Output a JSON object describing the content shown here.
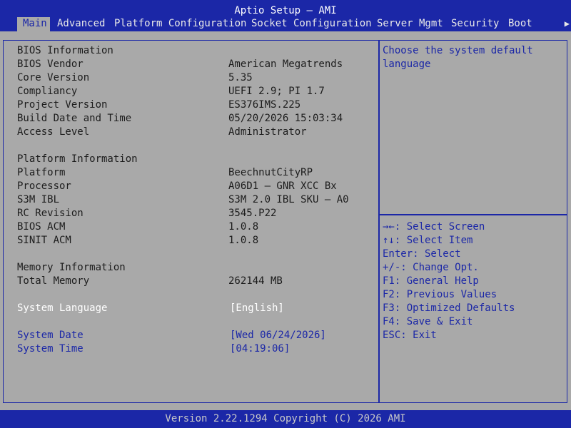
{
  "title": "Aptio Setup – AMI",
  "tabs": [
    "Main",
    "Advanced",
    "Platform Configuration",
    "Socket Configuration",
    "Server Mgmt",
    "Security",
    "Boot"
  ],
  "tab_more_arrow": "▶",
  "bios": {
    "section": "BIOS Information",
    "vendor_label": "BIOS Vendor",
    "vendor": "American Megatrends",
    "core_label": "Core Version",
    "core": "5.35",
    "compliancy_label": "Compliancy",
    "compliancy": "UEFI 2.9; PI 1.7",
    "project_label": "Project Version",
    "project": "ES376IMS.225",
    "build_label": "Build Date and Time",
    "build": "05/20/2026 15:03:34",
    "access_label": "Access Level",
    "access": "Administrator"
  },
  "platform": {
    "section": "Platform Information",
    "platform_label": "Platform",
    "platform": "BeechnutCityRP",
    "processor_label": "Processor",
    "processor": "A06D1 – GNR XCC Bx",
    "s3m_label": "S3M IBL",
    "s3m": "S3M 2.0 IBL SKU – A0",
    "rc_label": "RC Revision",
    "rc": "3545.P22",
    "acm_label": "BIOS ACM",
    "acm": "1.0.8",
    "sinit_label": "SINIT ACM",
    "sinit": "1.0.8"
  },
  "memory": {
    "section": "Memory Information",
    "total_label": "Total Memory",
    "total": "262144 MB"
  },
  "settings": {
    "language_label": "System Language",
    "language": "[English]",
    "date_label": "System Date",
    "date": "[Wed 06/24/2026]",
    "time_label": "System Time",
    "time": "[04:19:06]"
  },
  "help": {
    "desc_line1": "Choose the system default",
    "desc_line2": "language",
    "keys": [
      "→←: Select Screen",
      "↑↓: Select Item",
      "Enter: Select",
      "+/-: Change Opt.",
      "F1: General Help",
      "F2: Previous Values",
      "F3: Optimized Defaults",
      "F4: Save & Exit",
      "ESC: Exit"
    ]
  },
  "footer": "Version 2.22.1294 Copyright (C) 2026 AMI",
  "colors": {
    "blue": "#1b27a7",
    "gray": "#a9a9a9",
    "text": "#1c1c1c",
    "highlight": "#ffffff"
  }
}
